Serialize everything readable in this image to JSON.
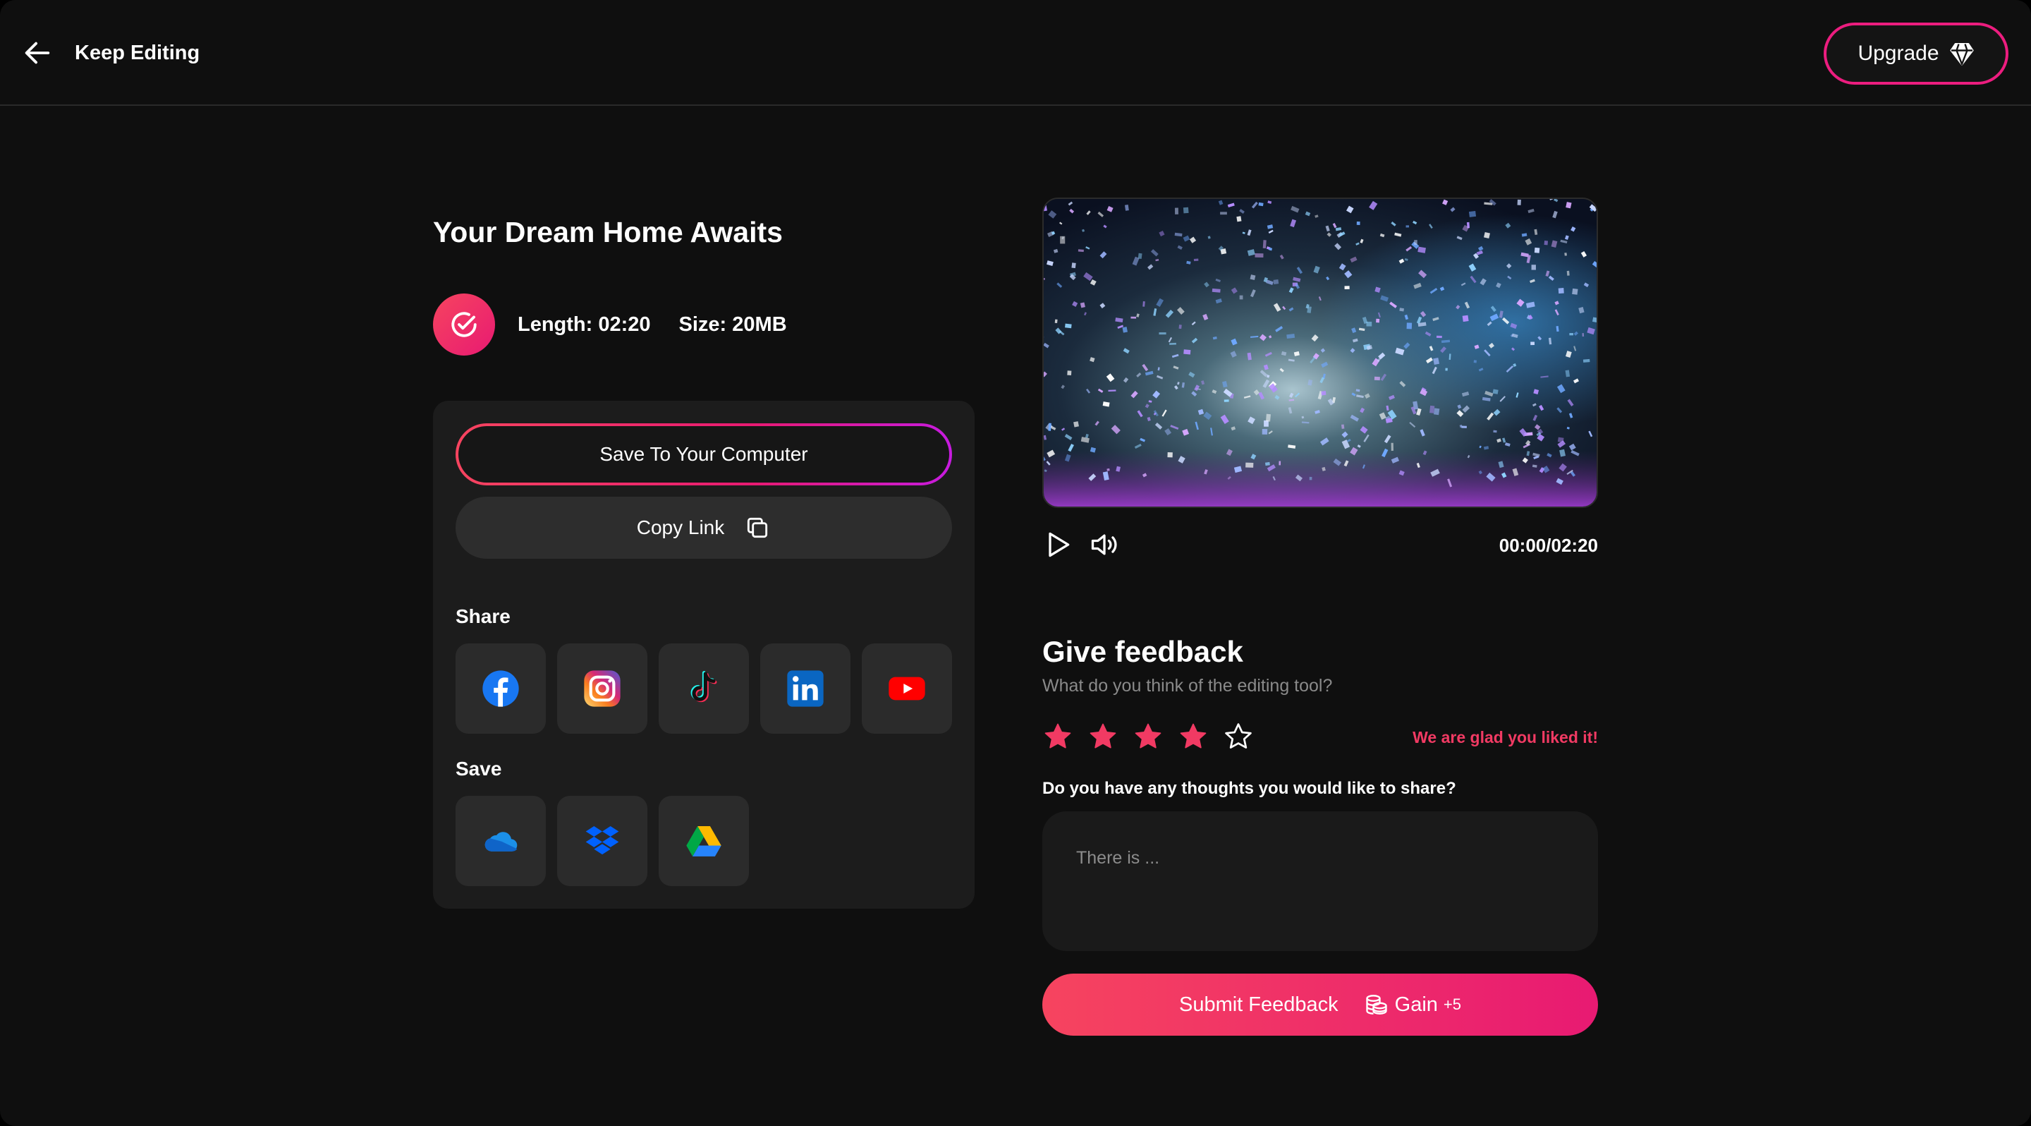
{
  "header": {
    "back_label": "Keep Editing",
    "upgrade_label": "Upgrade"
  },
  "project": {
    "title": "Your Dream Home Awaits",
    "length": "Length: 02:20",
    "size": "Size: 20MB"
  },
  "actions": {
    "save_label": "Save To Your Computer",
    "copy_label": "Copy Link"
  },
  "share": {
    "label": "Share",
    "items": [
      "facebook-icon",
      "instagram-icon",
      "tiktok-icon",
      "linkedin-icon",
      "youtube-icon"
    ]
  },
  "save": {
    "label": "Save",
    "items": [
      "onedrive-icon",
      "dropbox-icon",
      "google-drive-icon"
    ]
  },
  "player": {
    "timecode": "00:00/02:20"
  },
  "feedback": {
    "title": "Give feedback",
    "subtitle": "What do you think of the editing tool?",
    "rating": 4,
    "max_rating": 5,
    "rating_message": "We are glad you liked it!",
    "question": "Do you have any thoughts you would like to share?",
    "placeholder": "There is ...",
    "submit_label": "Submit Feedback",
    "gain_label": "Gain",
    "gain_value": "+5"
  },
  "colors": {
    "accent": "#ec1d7f",
    "accent_start": "#f6445f",
    "background": "#0f0f0f",
    "panel": "#1c1c1c"
  }
}
